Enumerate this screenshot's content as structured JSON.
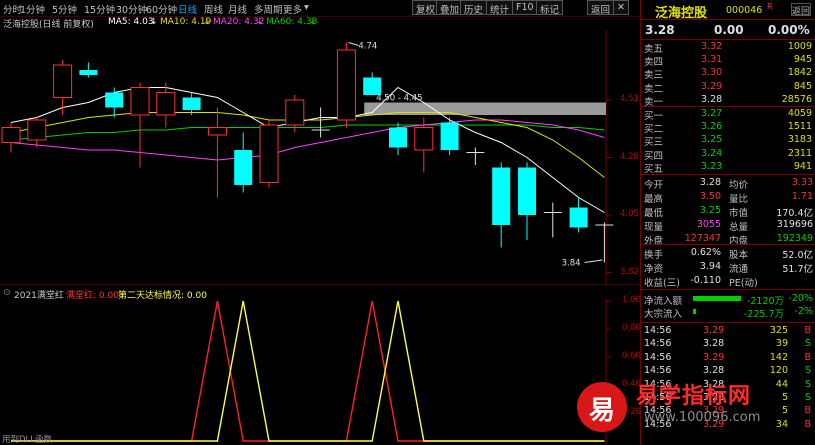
{
  "toolbar": {
    "periods": [
      "分时",
      "1分钟",
      "5分钟",
      "15分钟",
      "30分钟",
      "60分钟",
      "日线",
      "周线",
      "月线",
      "多周期",
      "更多"
    ],
    "active_period": "日线",
    "buttons": [
      "复权",
      "叠加",
      "历史",
      "统计",
      "F10",
      "标记",
      "返回"
    ]
  },
  "chart_header": {
    "stock_title": "泛海控股(日线 前复权)",
    "ma5": "MA5: 4.03",
    "ma10": "MA10: 4.19",
    "ma20": "MA20: 4.32",
    "ma60": "MA60: 4.38",
    "arrow_ma5": "↓",
    "arrow_ma10": "↓",
    "arrow_ma20": "↓",
    "arrow_ma60": "↓"
  },
  "price_axis": [
    "4.51",
    "4.28",
    "4.05",
    "3.82"
  ],
  "annotations": {
    "high": "4.74",
    "band": "4.50 - 4.45",
    "low": "3.84"
  },
  "indicator_header": {
    "name": "2021满堂红",
    "label1": "满堂红: 0.00",
    "label2": "第二天达标情况: 0.00"
  },
  "indicator_axis": [
    "1.00",
    "0.80",
    "0.60",
    "0.40",
    "0.20"
  ],
  "bottom_tabs": "用到DLL函数",
  "colors": {
    "up": "#ff3030",
    "down": "#00ffff",
    "ma5": "#ffffff",
    "ma10": "#e0e000",
    "ma20": "#ff40ff",
    "ma60": "#00d000",
    "ind_red": "#ff2020",
    "ind_yellow": "#ffff40"
  },
  "chart_data": {
    "type": "candlestick",
    "price_range": [
      3.82,
      4.74
    ],
    "candles": [
      {
        "o": 4.34,
        "h": 4.42,
        "l": 4.3,
        "c": 4.4
      },
      {
        "o": 4.35,
        "h": 4.44,
        "l": 4.32,
        "c": 4.43
      },
      {
        "o": 4.52,
        "h": 4.67,
        "l": 4.45,
        "c": 4.65
      },
      {
        "o": 4.63,
        "h": 4.66,
        "l": 4.6,
        "c": 4.61
      },
      {
        "o": 4.54,
        "h": 4.56,
        "l": 4.44,
        "c": 4.48
      },
      {
        "o": 4.45,
        "h": 4.58,
        "l": 4.24,
        "c": 4.56
      },
      {
        "o": 4.45,
        "h": 4.58,
        "l": 4.4,
        "c": 4.54
      },
      {
        "o": 4.52,
        "h": 4.54,
        "l": 4.45,
        "c": 4.47
      },
      {
        "o": 4.37,
        "h": 4.48,
        "l": 4.12,
        "c": 4.4
      },
      {
        "o": 4.31,
        "h": 4.38,
        "l": 4.14,
        "c": 4.17
      },
      {
        "o": 4.18,
        "h": 4.43,
        "l": 4.16,
        "c": 4.41
      },
      {
        "o": 4.41,
        "h": 4.53,
        "l": 4.38,
        "c": 4.51
      },
      {
        "o": 4.38,
        "h": 4.48,
        "l": 4.36,
        "c": 4.39
      },
      {
        "o": 4.43,
        "h": 4.74,
        "l": 4.4,
        "c": 4.71
      },
      {
        "o": 4.6,
        "h": 4.62,
        "l": 4.53,
        "c": 4.53
      },
      {
        "o": 4.4,
        "h": 4.42,
        "l": 4.29,
        "c": 4.32
      },
      {
        "o": 4.31,
        "h": 4.44,
        "l": 4.22,
        "c": 4.4
      },
      {
        "o": 4.42,
        "h": 4.44,
        "l": 4.29,
        "c": 4.31
      },
      {
        "o": 4.3,
        "h": 4.32,
        "l": 4.25,
        "c": 4.3
      },
      {
        "o": 4.24,
        "h": 4.26,
        "l": 3.92,
        "c": 4.01
      },
      {
        "o": 4.24,
        "h": 4.26,
        "l": 3.95,
        "c": 4.05
      },
      {
        "o": 4.06,
        "h": 4.1,
        "l": 3.96,
        "c": 4.06
      },
      {
        "o": 4.08,
        "h": 4.12,
        "l": 3.98,
        "c": 4.0
      },
      {
        "o": 4.01,
        "h": 4.02,
        "l": 3.86,
        "c": 4.01
      }
    ],
    "ma5": [
      4.42,
      4.44,
      4.48,
      4.5,
      4.54,
      4.56,
      4.56,
      4.54,
      4.52,
      4.46,
      4.4,
      4.42,
      4.44,
      4.44,
      4.46,
      4.56,
      4.5,
      4.43,
      4.38,
      4.34,
      4.28,
      4.2,
      4.12,
      4.06
    ],
    "ma10": [
      4.38,
      4.4,
      4.42,
      4.44,
      4.45,
      4.46,
      4.46,
      4.46,
      4.46,
      4.45,
      4.43,
      4.43,
      4.43,
      4.44,
      4.45,
      4.46,
      4.46,
      4.46,
      4.44,
      4.42,
      4.4,
      4.35,
      4.28,
      4.2
    ],
    "ma20": [
      4.34,
      4.33,
      4.32,
      4.31,
      4.31,
      4.3,
      4.29,
      4.28,
      4.27,
      4.28,
      4.29,
      4.32,
      4.34,
      4.36,
      4.38,
      4.4,
      4.41,
      4.42,
      4.43,
      4.43,
      4.42,
      4.41,
      4.39,
      4.36
    ],
    "ma60": [
      4.35,
      4.36,
      4.37,
      4.38,
      4.38,
      4.39,
      4.39,
      4.4,
      4.4,
      4.4,
      4.4,
      4.4,
      4.4,
      4.41,
      4.41,
      4.41,
      4.41,
      4.41,
      4.41,
      4.41,
      4.41,
      4.4,
      4.4,
      4.39
    ],
    "band": [
      4.45,
      4.5
    ],
    "indicator_red_peaks": [
      8,
      14
    ],
    "indicator_yellow_peaks": [
      9,
      15
    ]
  },
  "right_panel": {
    "title": "泛海控股",
    "code": "000046",
    "badge": "R",
    "price": "3.28",
    "change": "0.00",
    "change_pct": "0.00%",
    "sells": [
      {
        "label": "卖五",
        "price": "3.32",
        "vol": "1009"
      },
      {
        "label": "卖四",
        "price": "3.31",
        "vol": "945"
      },
      {
        "label": "卖三",
        "price": "3.30",
        "vol": "1842"
      },
      {
        "label": "卖二",
        "price": "3.29",
        "vol": "845"
      },
      {
        "label": "卖一",
        "price": "3.28",
        "vol": "28576"
      }
    ],
    "buys": [
      {
        "label": "买一",
        "price": "3.27",
        "vol": "4059"
      },
      {
        "label": "买二",
        "price": "3.26",
        "vol": "1511"
      },
      {
        "label": "买三",
        "price": "3.25",
        "vol": "3183"
      },
      {
        "label": "买四",
        "price": "3.24",
        "vol": "2311"
      },
      {
        "label": "买五",
        "price": "3.23",
        "vol": "941"
      }
    ],
    "stats": [
      {
        "l1": "今开",
        "v1": "3.28",
        "l2": "均价",
        "v2": "3.33"
      },
      {
        "l1": "最高",
        "v1": "3.50",
        "l2": "量比",
        "v2": "1.71"
      },
      {
        "l1": "最低",
        "v1": "3.25",
        "l2": "市值",
        "v2": "170.4亿"
      },
      {
        "l1": "现量",
        "v1": "3055",
        "l2": "总量",
        "v2": "319696"
      },
      {
        "l1": "外盘",
        "v1": "127347",
        "l2": "内盘",
        "v2": "192349"
      }
    ],
    "stats2": [
      {
        "l1": "换手",
        "v1": "0.62%",
        "l2": "股本",
        "v2": "52.0亿"
      },
      {
        "l1": "净资",
        "v1": "3.94",
        "l2": "流通",
        "v2": "51.7亿"
      },
      {
        "l1": "收益(三)",
        "v1": "-0.110",
        "l2": "PE(动)",
        "v2": ""
      }
    ],
    "flows": [
      {
        "label": "净流入额",
        "value": "-2120万",
        "pct": "-20%"
      },
      {
        "label": "大宗流入",
        "value": "-225.7万",
        "pct": "-2%"
      }
    ],
    "ticks": [
      {
        "time": "14:56",
        "price": "3.29",
        "vol": "325",
        "side": "B"
      },
      {
        "time": "14:56",
        "price": "3.28",
        "vol": "39",
        "side": "S"
      },
      {
        "time": "14:56",
        "price": "3.29",
        "vol": "142",
        "side": "B"
      },
      {
        "time": "14:56",
        "price": "3.28",
        "vol": "120",
        "side": "S"
      },
      {
        "time": "14:56",
        "price": "3.28",
        "vol": "44",
        "side": "S"
      },
      {
        "time": "14:56",
        "price": "3.28",
        "vol": "5",
        "side": "S"
      },
      {
        "time": "14:56",
        "price": "3.29",
        "vol": "5",
        "side": "B"
      },
      {
        "time": "14:56",
        "price": "3.29",
        "vol": "34",
        "side": "B"
      }
    ],
    "watermark_text": "易学指标网",
    "watermark_url": "www.100096.com",
    "watermark_logo": "易"
  }
}
